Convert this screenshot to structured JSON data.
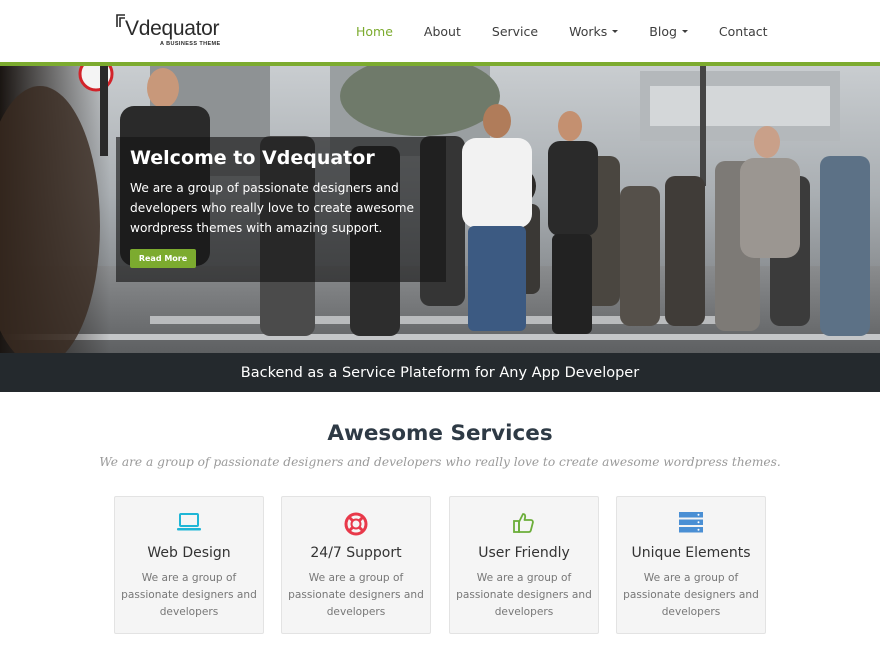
{
  "brand": {
    "name": "Vdequator",
    "tagline": "A BUSINESS THEME"
  },
  "nav": {
    "items": [
      {
        "label": "Home",
        "active": true,
        "dropdown": false
      },
      {
        "label": "About",
        "active": false,
        "dropdown": false
      },
      {
        "label": "Service",
        "active": false,
        "dropdown": false
      },
      {
        "label": "Works",
        "active": false,
        "dropdown": true
      },
      {
        "label": "Blog",
        "active": false,
        "dropdown": true
      },
      {
        "label": "Contact",
        "active": false,
        "dropdown": false
      }
    ]
  },
  "hero": {
    "title": "Welcome to Vdequator",
    "text": "We are a group of passionate designers and developers who really love to create awesome wordpress themes with amazing support.",
    "button_label": "Read More"
  },
  "tagline_bar": {
    "text": "Backend as a Service Plateform for Any App Developer"
  },
  "services": {
    "title_bold": "Awesome",
    "title_rest": " Services",
    "subtitle": "We are a group of passionate designers and developers who really love to create awesome wordpress themes.",
    "cards": [
      {
        "icon": "laptop-icon",
        "icon_color": "#1fb6d6",
        "title": "Web Design",
        "text": "We are a group of passionate designers and developers"
      },
      {
        "icon": "lifebuoy-icon",
        "icon_color": "#e8394a",
        "title": "24/7 Support",
        "text": "We are a group of passionate designers and developers"
      },
      {
        "icon": "thumbs-up-icon",
        "icon_color": "#6cae3a",
        "title": "User Friendly",
        "text": "We are a group of passionate designers and developers"
      },
      {
        "icon": "server-icon",
        "icon_color": "#4a8fd4",
        "title": "Unique Elements",
        "text": "We are a group of passionate designers and developers"
      }
    ]
  },
  "colors": {
    "accent": "#7cab2f",
    "dark_bar": "#24292d"
  }
}
